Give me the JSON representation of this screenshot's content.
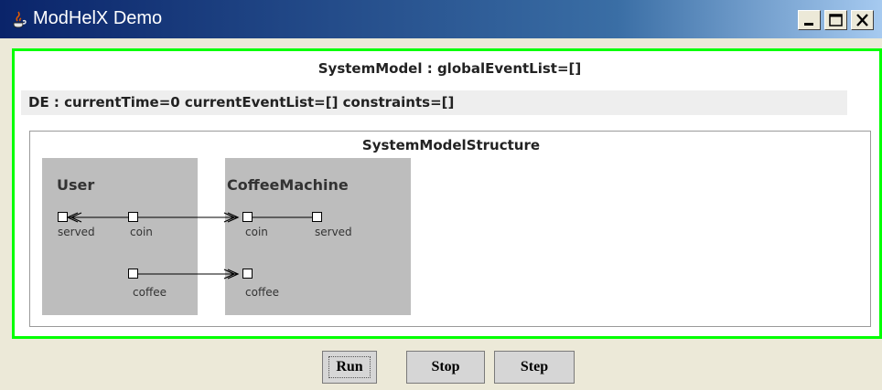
{
  "window": {
    "title": "ModHelX Demo",
    "controls": [
      "minimize-icon",
      "maximize-icon",
      "close-icon"
    ],
    "frame_icon": "java-icon"
  },
  "system": {
    "title": "SystemModel : globalEventList=[]",
    "de_status": "DE : currentTime=0 currentEventList=[] constraints=[]",
    "structure_title": "SystemModelStructure"
  },
  "blocks": [
    {
      "name": "User",
      "ports": [
        "served",
        "coin",
        "coffee"
      ]
    },
    {
      "name": "CoffeeMachine",
      "ports": [
        "coin",
        "served",
        "coffee"
      ]
    }
  ],
  "buttons": {
    "run": "Run",
    "stop": "Stop",
    "step": "Step"
  },
  "colors": {
    "title_gradient_start": "#0a246a",
    "title_gradient_end": "#a6caf0",
    "active_border": "#00ff00",
    "block_fill": "#bdbdbd"
  }
}
